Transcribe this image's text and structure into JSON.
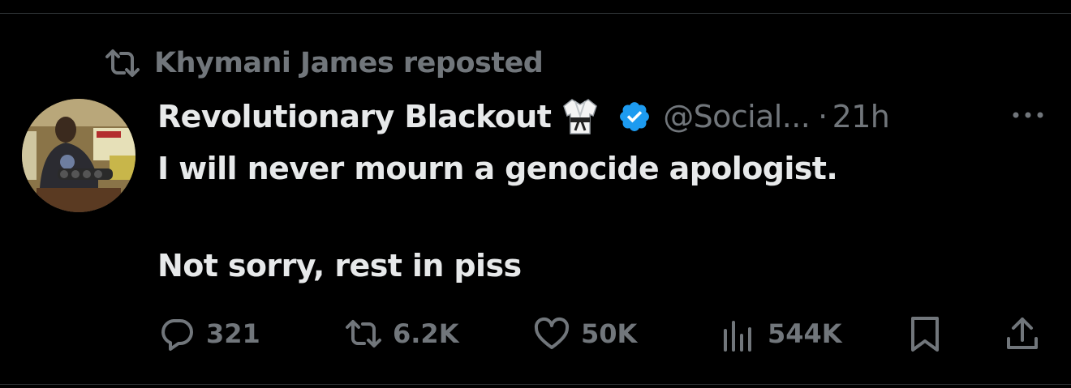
{
  "repost": {
    "icon": "repost-icon",
    "text": "Khymani James reposted"
  },
  "author": {
    "display_name": "Revolutionary Blackout",
    "emoji_icon": "martial-arts-uniform-icon",
    "verified": true,
    "verified_color": "#1d9bf0",
    "handle": "@Social...",
    "separator": "·",
    "time": "21h"
  },
  "tweet": {
    "line1": "I will never mourn a genocide apologist.",
    "line2": "Not sorry, rest in piss"
  },
  "actions": {
    "replies": "321",
    "reposts": "6.2K",
    "likes": "50K",
    "views": "544K"
  },
  "colors": {
    "background": "#000000",
    "text": "#e7e9ea",
    "muted": "#71767b"
  }
}
